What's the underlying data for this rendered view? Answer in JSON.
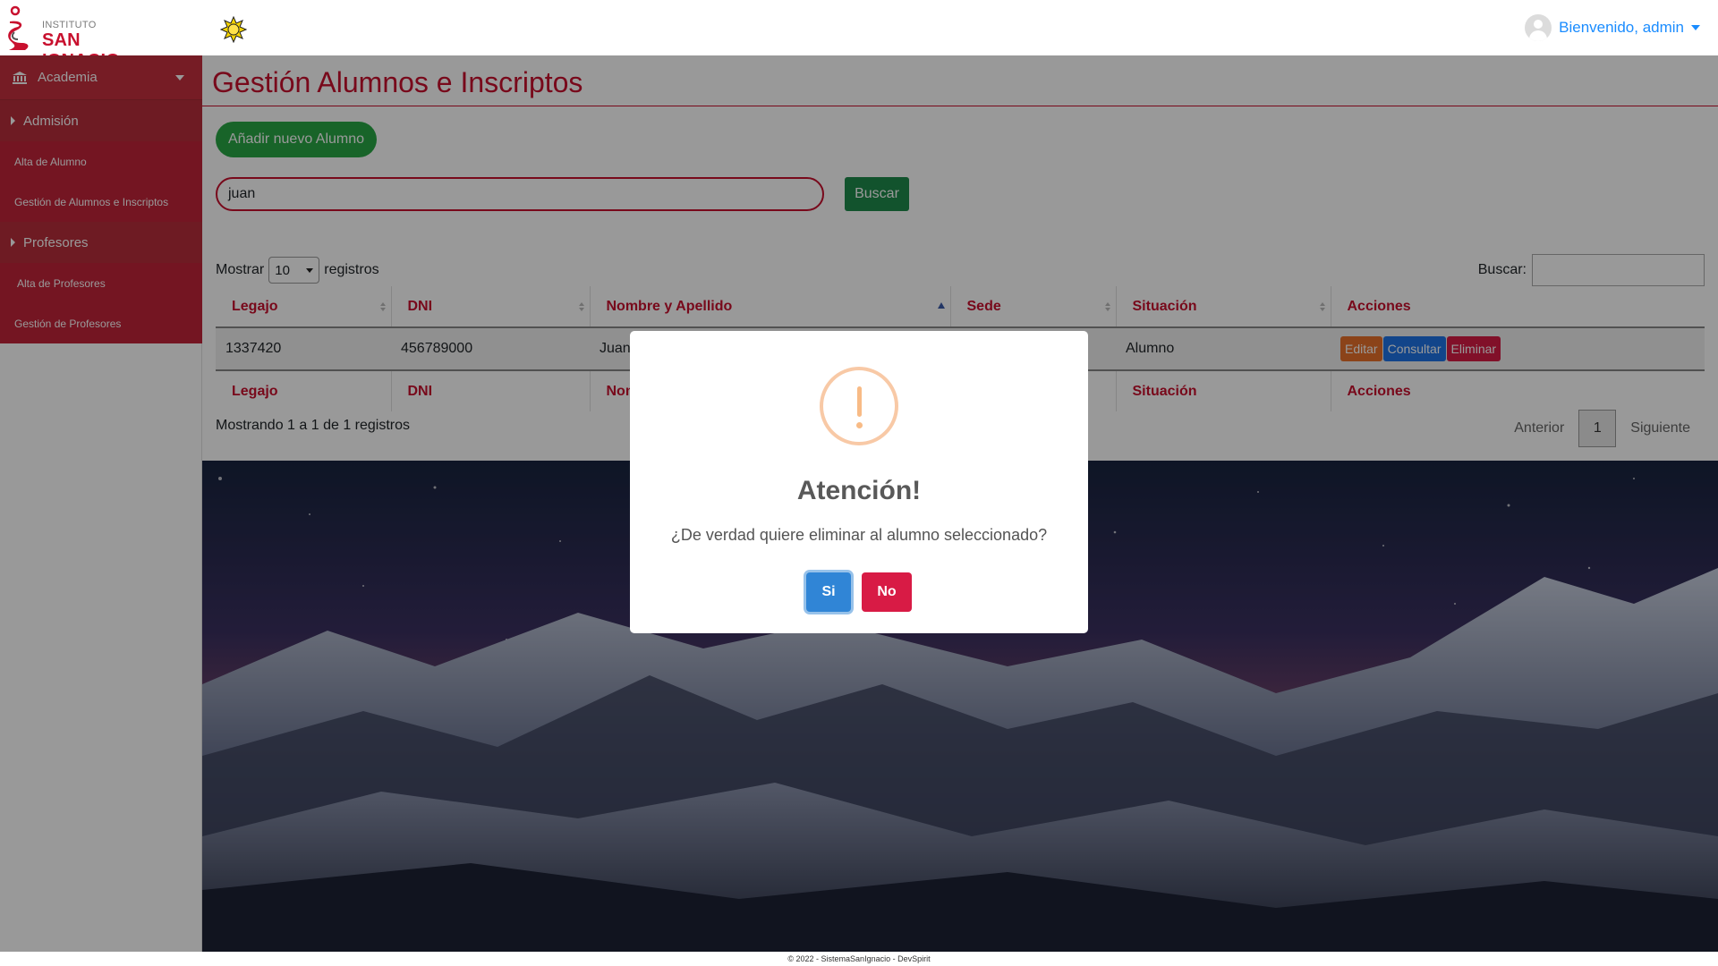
{
  "brand": {
    "small": "INSTITUTO",
    "name": "SAN IGNACIO"
  },
  "user": {
    "greeting": "Bienvenido, admin"
  },
  "sidebar": {
    "main_menu": "Academia",
    "sections": [
      {
        "label": "Admisión",
        "links": [
          "Alta de Alumno",
          "Gestión de Alumnos e Inscriptos"
        ]
      },
      {
        "label": "Profesores",
        "links": [
          "Alta de Profesores",
          "Gestión de Profesores"
        ]
      }
    ]
  },
  "page": {
    "title": "Gestión Alumnos e Inscriptos",
    "add_button": "Añadir nuevo Alumno",
    "search_value": "juan",
    "search_button": "Buscar"
  },
  "table": {
    "length_prefix": "Mostrar",
    "length_value": "10",
    "length_suffix": "registros",
    "filter_label": "Buscar:",
    "filter_value": "",
    "columns": [
      "Legajo",
      "DNI",
      "Nombre y Apellido",
      "Sede",
      "Situación",
      "Acciones"
    ],
    "rows": [
      {
        "legajo": "1337420",
        "dni": "456789000",
        "nombre": "Juan",
        "sede": "",
        "situacion": "Alumno"
      }
    ],
    "actions": [
      "Editar",
      "Consultar",
      "Eliminar"
    ],
    "info": "Mostrando 1 a 1 de 1 registros",
    "pager": {
      "prev": "Anterior",
      "current": "1",
      "next": "Siguiente"
    }
  },
  "modal": {
    "title": "Atención!",
    "message": "¿De verdad quiere eliminar al alumno seleccionado?",
    "confirm": "Si",
    "cancel": "No"
  },
  "footer": "© 2022 - SistemaSanIgnacio - DevSpirit",
  "colors": {
    "brand_red": "#c8102e",
    "sidebar_red": "#c2233a",
    "success_green": "#28a745",
    "warning_orange": "#f8bb86",
    "confirm_blue": "#3085d6",
    "danger_pink": "#d81b45"
  }
}
